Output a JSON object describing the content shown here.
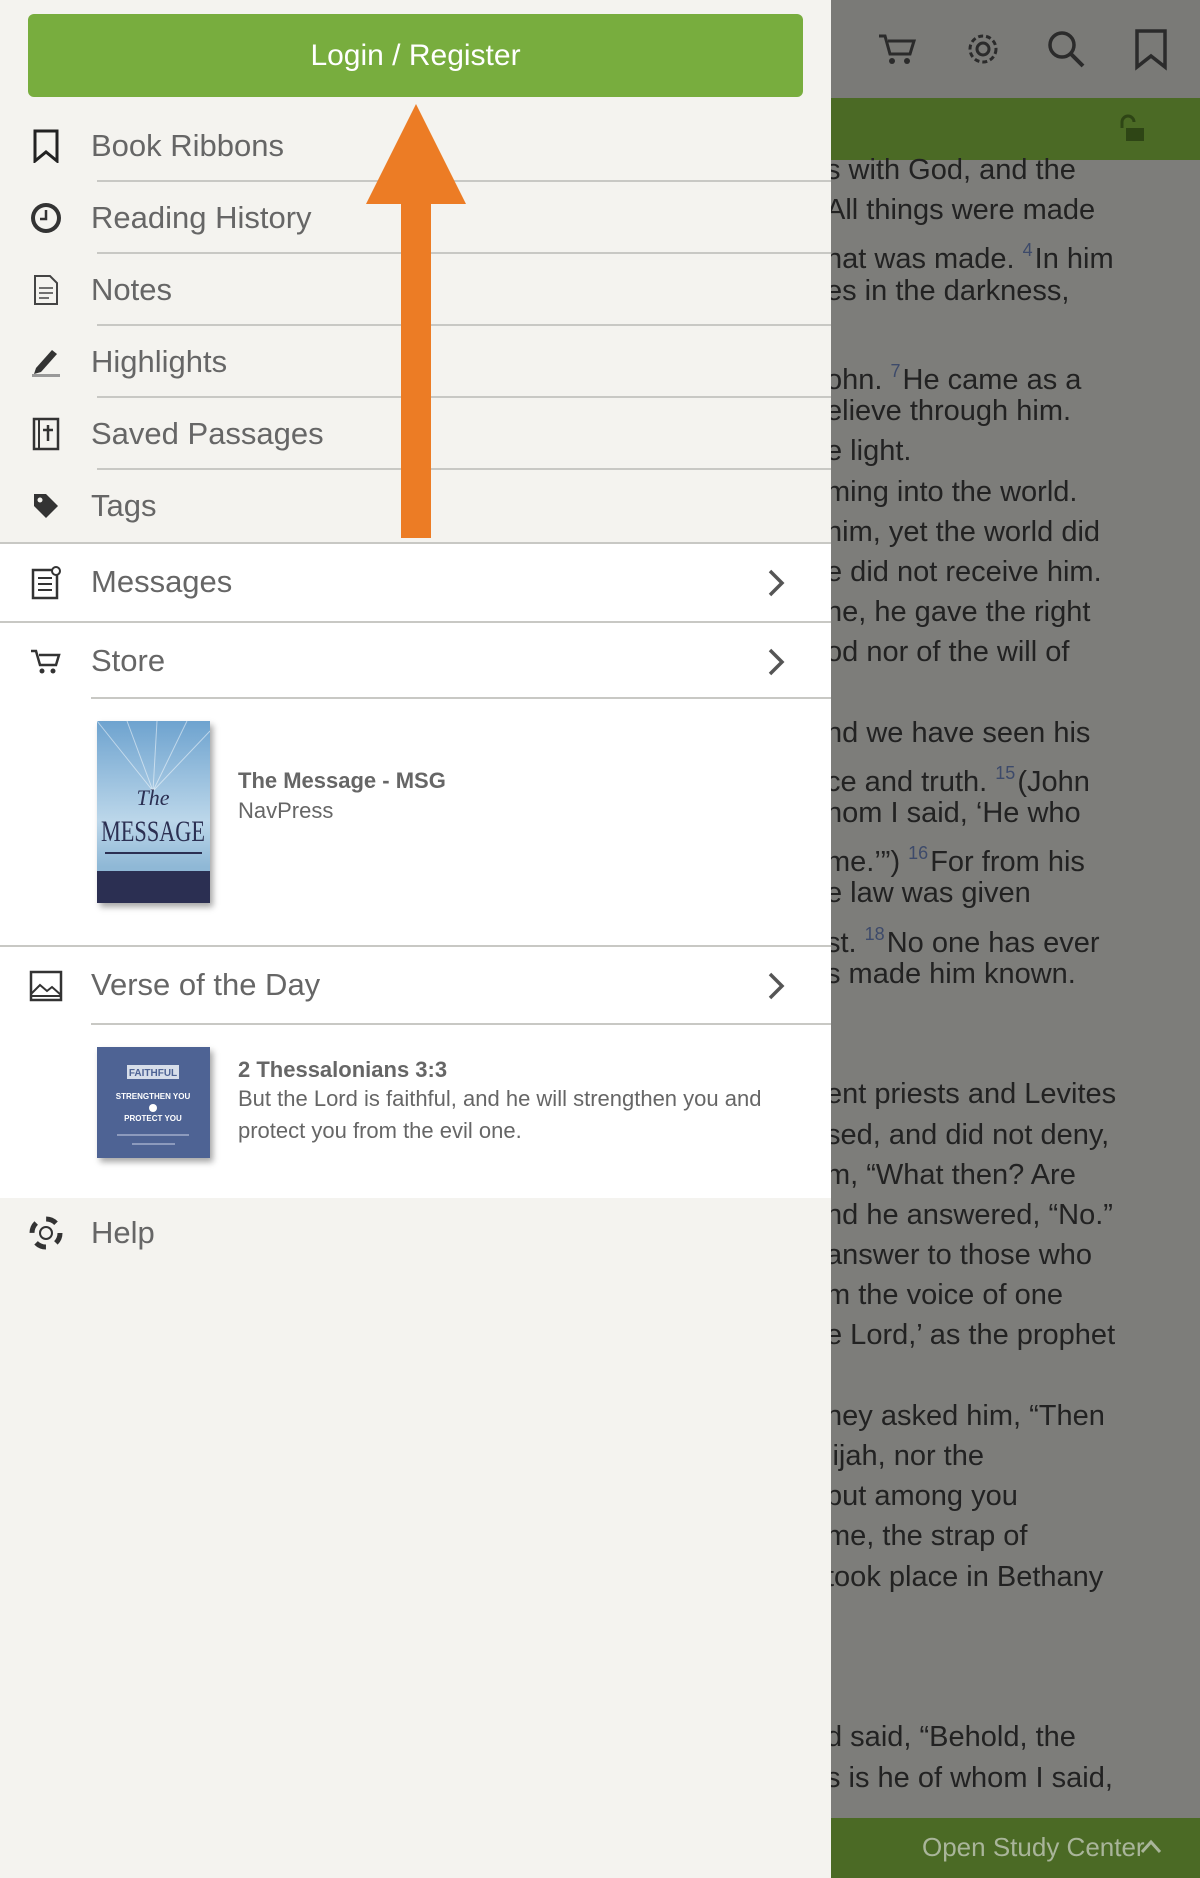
{
  "drawer": {
    "login_label": "Login / Register",
    "menu": [
      {
        "label": "Book Ribbons",
        "icon": "bookmark-icon"
      },
      {
        "label": "Reading History",
        "icon": "clock-icon"
      },
      {
        "label": "Notes",
        "icon": "note-icon"
      },
      {
        "label": "Highlights",
        "icon": "highlighter-icon"
      },
      {
        "label": "Saved Passages",
        "icon": "bible-icon"
      },
      {
        "label": "Tags",
        "icon": "tag-icon"
      }
    ],
    "messages_label": "Messages",
    "store": {
      "label": "Store",
      "book_title": "The Message - MSG",
      "book_publisher": "NavPress",
      "cover_script_word": "The",
      "cover_main_word": "MESSAGE"
    },
    "verse_of_day": {
      "label": "Verse of the Day",
      "reference": "2 Thessalonians 3:3",
      "text_line1": "But the Lord is faithful, and he will strengthen you and",
      "text_line2": "protect you from the evil one.",
      "thumb_word1": "FAITHFUL",
      "thumb_word2": "STRENGTHEN YOU",
      "thumb_word3": "PROTECT YOU"
    },
    "help_label": "Help"
  },
  "reader": {
    "lines": [
      {
        "v": "",
        "t": "s with God, and the"
      },
      {
        "v": "",
        "t": "All things were made"
      },
      {
        "v": "4",
        "pre": "hat was made. ",
        "t": "In him"
      },
      {
        "v": "",
        "t": "es in the darkness,"
      },
      {
        "gap": true
      },
      {
        "v": "7",
        "pre": "ohn. ",
        "t": "He came as a"
      },
      {
        "v": "",
        "t": "elieve through him."
      },
      {
        "v": "",
        "t": "e light."
      },
      {
        "v": "",
        "t": "ming into the world."
      },
      {
        "v": "",
        "t": " him, yet the world did"
      },
      {
        "v": "",
        "t": "e did not receive him."
      },
      {
        "v": "",
        "t": "ne, he gave the right"
      },
      {
        "v": "",
        "t": "od nor of the will of"
      },
      {
        "gap": true
      },
      {
        "v": "",
        "t": "nd we have seen his"
      },
      {
        "v": "15",
        "pre": "ce and truth. ",
        "t": "(John"
      },
      {
        "v": "",
        "t": "hom I said, ‘He who"
      },
      {
        "v": "16",
        "pre": "me.’”) ",
        "t": "For from his"
      },
      {
        "v": "",
        "t": "e law was given"
      },
      {
        "v": "18",
        "pre": "st. ",
        "t": "No one has ever"
      },
      {
        "v": "",
        "t": "s made him known."
      },
      {
        "gap": true
      },
      {
        "gap": true
      },
      {
        "v": "",
        "t": "ent priests and Levites"
      },
      {
        "v": "",
        "t": "sed, and did not deny,"
      },
      {
        "v": "",
        "t": "m, “What then? Are"
      },
      {
        "v": "",
        "t": "nd he answered, “No.”"
      },
      {
        "v": "",
        "t": " answer to those who"
      },
      {
        "v": "",
        "t": "m the voice of one"
      },
      {
        "v": "",
        "t": "e Lord,’ as the prophet"
      },
      {
        "gap": true
      },
      {
        "v": "",
        "t": "ney asked him, “Then"
      },
      {
        "v": "",
        "t": "lijah, nor the"
      },
      {
        "v": "",
        "t": " but among you"
      },
      {
        "v": "",
        "t": " me, the strap of"
      },
      {
        "v": "",
        "t": "took place in Bethany"
      },
      {
        "gap": true
      },
      {
        "gap": true
      },
      {
        "gap": true
      },
      {
        "v": "",
        "t": "d said, “Behold, the"
      },
      {
        "v": "",
        "t": "s is he of whom I said,"
      }
    ],
    "open_study_label": "Open Study Center"
  },
  "colors": {
    "login_green": "#78ad3e",
    "arrow_orange": "#ec7c25",
    "drawer_bg": "#f4f3ef"
  }
}
